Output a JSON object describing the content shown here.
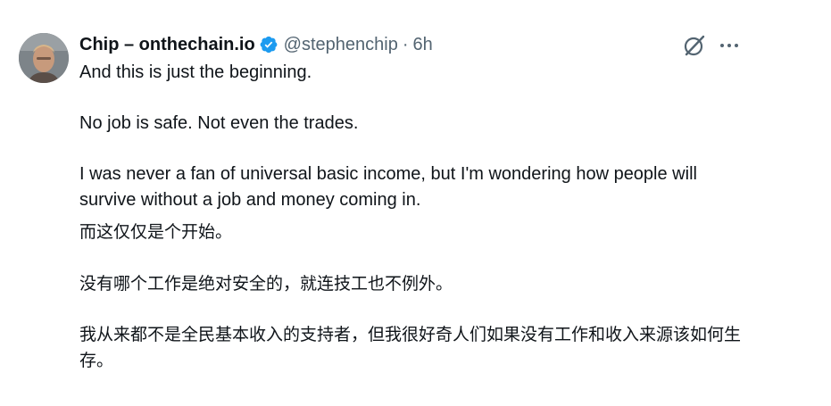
{
  "tweet": {
    "author": {
      "display_name": "Chip – onthechain.io",
      "handle": "@stephenchip",
      "time": "6h",
      "separator": "·",
      "avatar_icon": "avatar",
      "verified_icon": "verified-badge-icon",
      "verified_color": "#1d9bf0"
    },
    "actions": {
      "grok_icon": "grok-icon",
      "more_icon": "more-icon"
    },
    "text_en": {
      "line1": "And this is just the beginning.",
      "line2": "No job is safe. Not even the trades.",
      "line3": "I was never a fan of universal basic income, but I'm wondering how people will survive without a job and money coming in."
    },
    "text_zh": {
      "line1": "而这仅仅是个开始。",
      "line2": "没有哪个工作是绝对安全的，就连技工也不例外。",
      "line3": "我从来都不是全民基本收入的支持者，但我很好奇人们如果没有工作和收入来源该如何生存。"
    }
  }
}
